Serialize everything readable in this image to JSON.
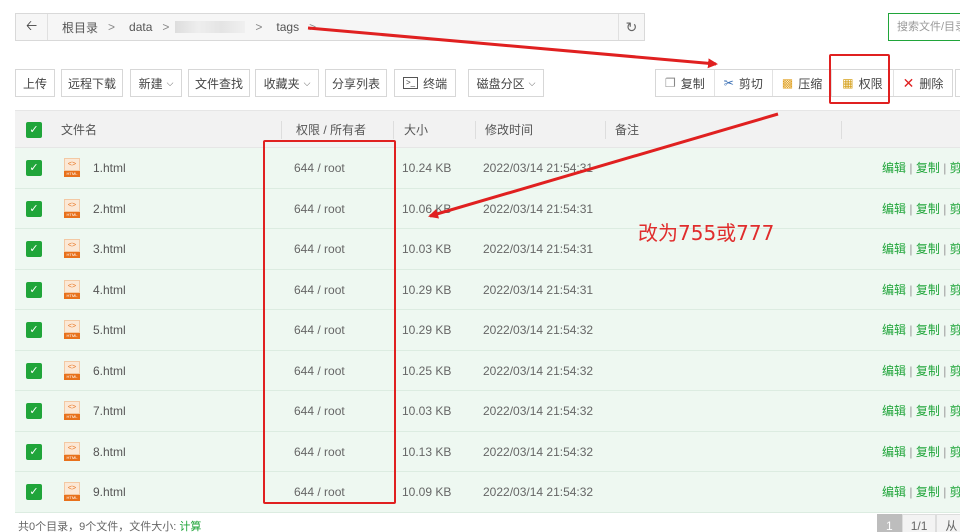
{
  "address_bar": {
    "back_icon": "arrow-left-icon",
    "crumbs": [
      "根目录",
      "data",
      "tags"
    ],
    "separator": ">",
    "refresh_icon": "refresh-icon"
  },
  "search": {
    "placeholder": "搜索文件/目录"
  },
  "toolbar": {
    "upload": "上传",
    "remote_download": "远程下载",
    "new": "新建",
    "find": "文件查找",
    "favorites": "收藏夹",
    "share_list": "分享列表",
    "terminal": "终端",
    "disk_partition": "磁盘分区",
    "copy": "复制",
    "cut": "剪切",
    "compress": "压缩",
    "permission": "权限",
    "delete": "删除"
  },
  "table": {
    "headers": {
      "name": "文件名",
      "permission_owner": "权限 / 所有者",
      "size": "大小",
      "modified": "修改时间",
      "note": "备注"
    },
    "icon_label": "HTML",
    "rows": [
      {
        "checked": true,
        "name": "1.html",
        "perm": "644 / root",
        "size": "10.24 KB",
        "time": "2022/03/14 21:54:31"
      },
      {
        "checked": true,
        "name": "2.html",
        "perm": "644 / root",
        "size": "10.06 KB",
        "time": "2022/03/14 21:54:31"
      },
      {
        "checked": true,
        "name": "3.html",
        "perm": "644 / root",
        "size": "10.03 KB",
        "time": "2022/03/14 21:54:31"
      },
      {
        "checked": true,
        "name": "4.html",
        "perm": "644 / root",
        "size": "10.29 KB",
        "time": "2022/03/14 21:54:31"
      },
      {
        "checked": true,
        "name": "5.html",
        "perm": "644 / root",
        "size": "10.29 KB",
        "time": "2022/03/14 21:54:32"
      },
      {
        "checked": true,
        "name": "6.html",
        "perm": "644 / root",
        "size": "10.25 KB",
        "time": "2022/03/14 21:54:32"
      },
      {
        "checked": true,
        "name": "7.html",
        "perm": "644 / root",
        "size": "10.03 KB",
        "time": "2022/03/14 21:54:32"
      },
      {
        "checked": true,
        "name": "8.html",
        "perm": "644 / root",
        "size": "10.13 KB",
        "time": "2022/03/14 21:54:32"
      },
      {
        "checked": true,
        "name": "9.html",
        "perm": "644 / root",
        "size": "10.09 KB",
        "time": "2022/03/14 21:54:32"
      }
    ],
    "row_ops": {
      "edit": "编辑",
      "copy": "复制",
      "cut": "剪切",
      "sep": "|"
    }
  },
  "footer": {
    "summary": "共0个目录，9个文件，文件大小:",
    "calc_link": "计算",
    "page_current": "1",
    "page_total": "1/1",
    "page_from": "从"
  },
  "annotation": {
    "text": "改为755或777",
    "color": "#e02d2d"
  },
  "colors": {
    "accent": "#20a53a",
    "row_bg": "#eef8f1"
  }
}
